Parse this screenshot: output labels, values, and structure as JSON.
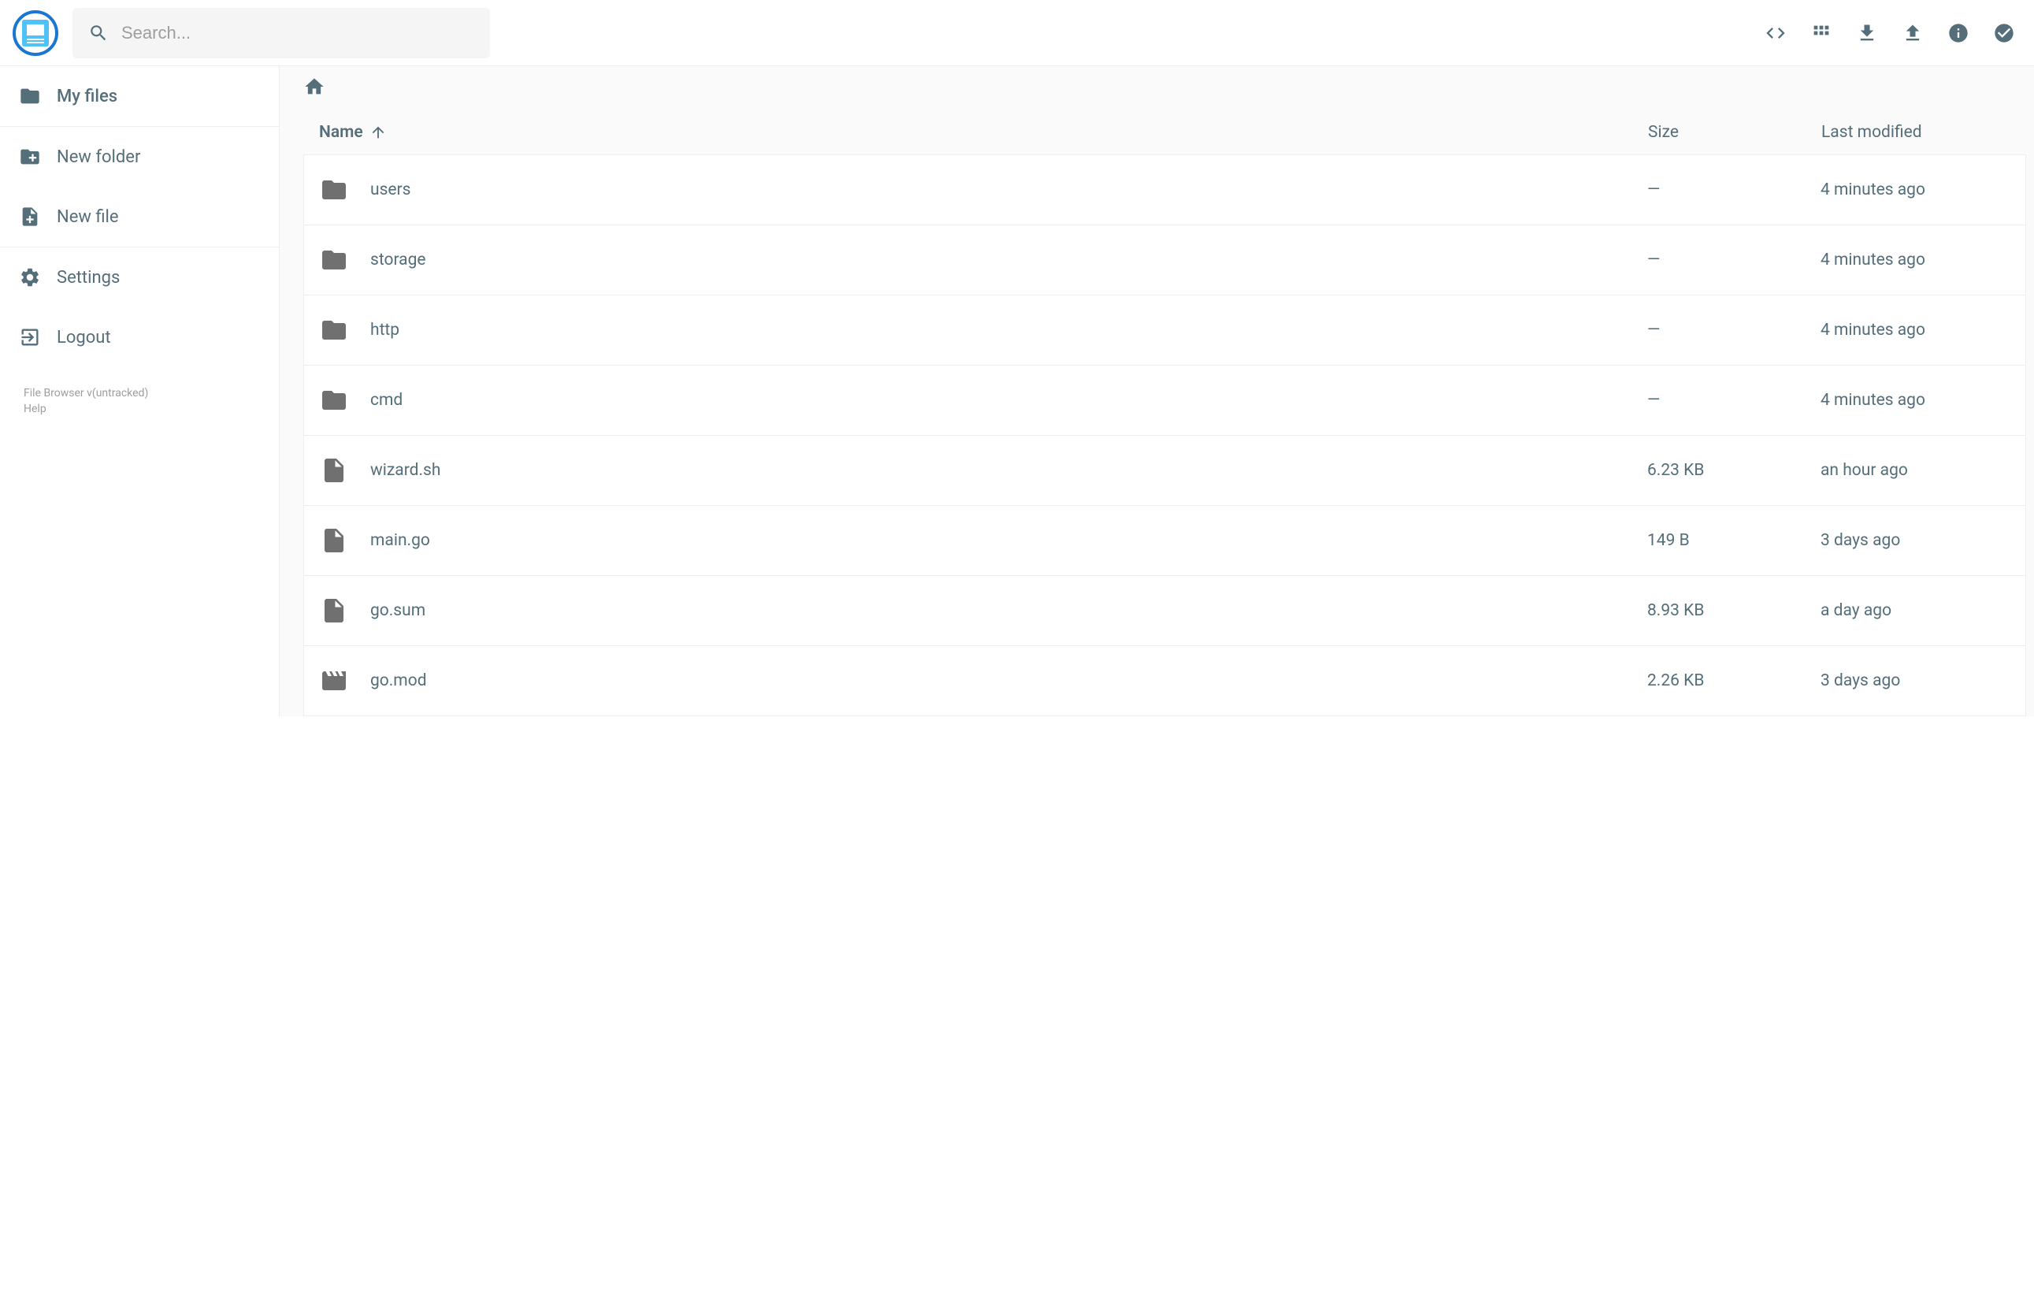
{
  "search": {
    "placeholder": "Search..."
  },
  "sidebar": {
    "items": [
      {
        "label": "My files",
        "icon": "folder"
      },
      {
        "label": "New folder",
        "icon": "create-folder"
      },
      {
        "label": "New file",
        "icon": "create-file"
      },
      {
        "label": "Settings",
        "icon": "settings"
      },
      {
        "label": "Logout",
        "icon": "logout"
      }
    ],
    "footer": {
      "version": "File Browser v(untracked)",
      "help": "Help"
    }
  },
  "columns": {
    "name": "Name",
    "size": "Size",
    "modified": "Last modified"
  },
  "files": [
    {
      "name": "users",
      "size": "—",
      "modified": "4 minutes ago",
      "icon": "folder"
    },
    {
      "name": "storage",
      "size": "—",
      "modified": "4 minutes ago",
      "icon": "folder"
    },
    {
      "name": "http",
      "size": "—",
      "modified": "4 minutes ago",
      "icon": "folder"
    },
    {
      "name": "cmd",
      "size": "—",
      "modified": "4 minutes ago",
      "icon": "folder"
    },
    {
      "name": "wizard.sh",
      "size": "6.23 KB",
      "modified": "an hour ago",
      "icon": "file"
    },
    {
      "name": "main.go",
      "size": "149 B",
      "modified": "3 days ago",
      "icon": "file"
    },
    {
      "name": "go.sum",
      "size": "8.93 KB",
      "modified": "a day ago",
      "icon": "file"
    },
    {
      "name": "go.mod",
      "size": "2.26 KB",
      "modified": "3 days ago",
      "icon": "movie"
    }
  ]
}
